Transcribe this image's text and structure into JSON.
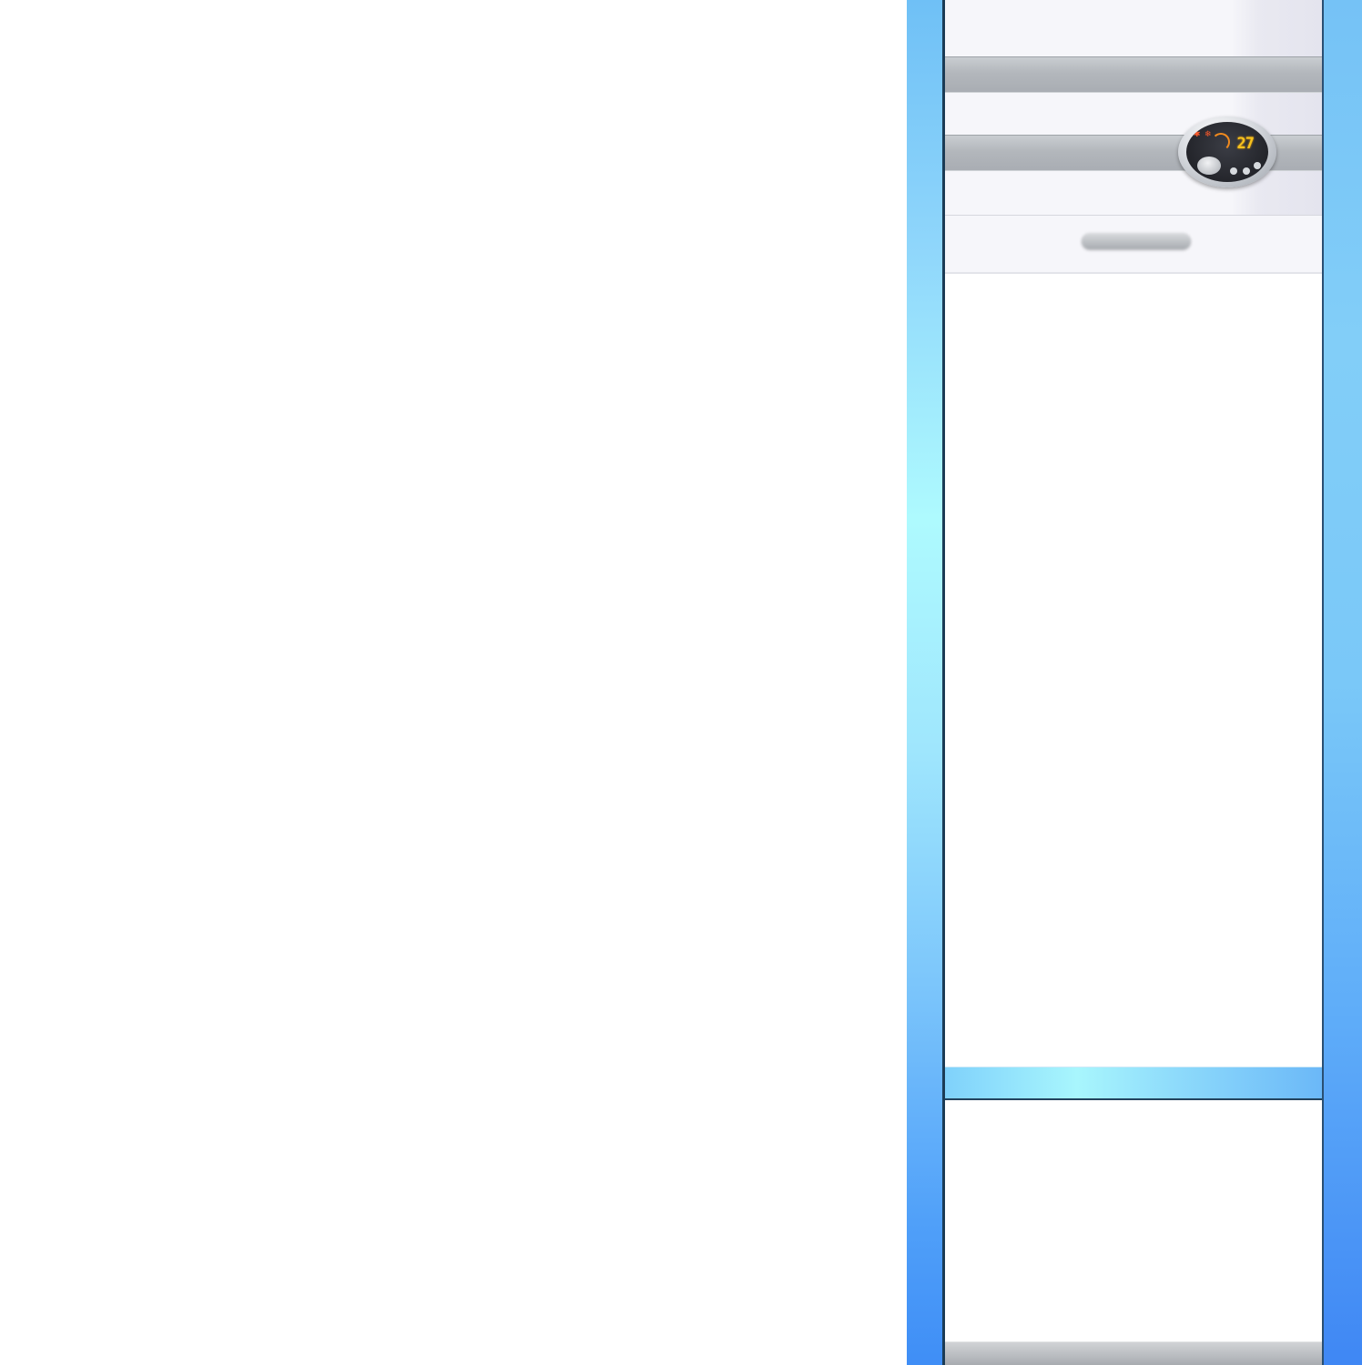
{
  "scene": {
    "subject": "floor-standing-air-conditioner",
    "background_color": "#ffffff"
  },
  "unit": {
    "frame_color": "#6fc0f6",
    "frame_accent_color": "#aefafe",
    "display": {
      "temperature": "27",
      "digit_color": "#f6c21e",
      "face_color": "#1a1b20"
    }
  }
}
